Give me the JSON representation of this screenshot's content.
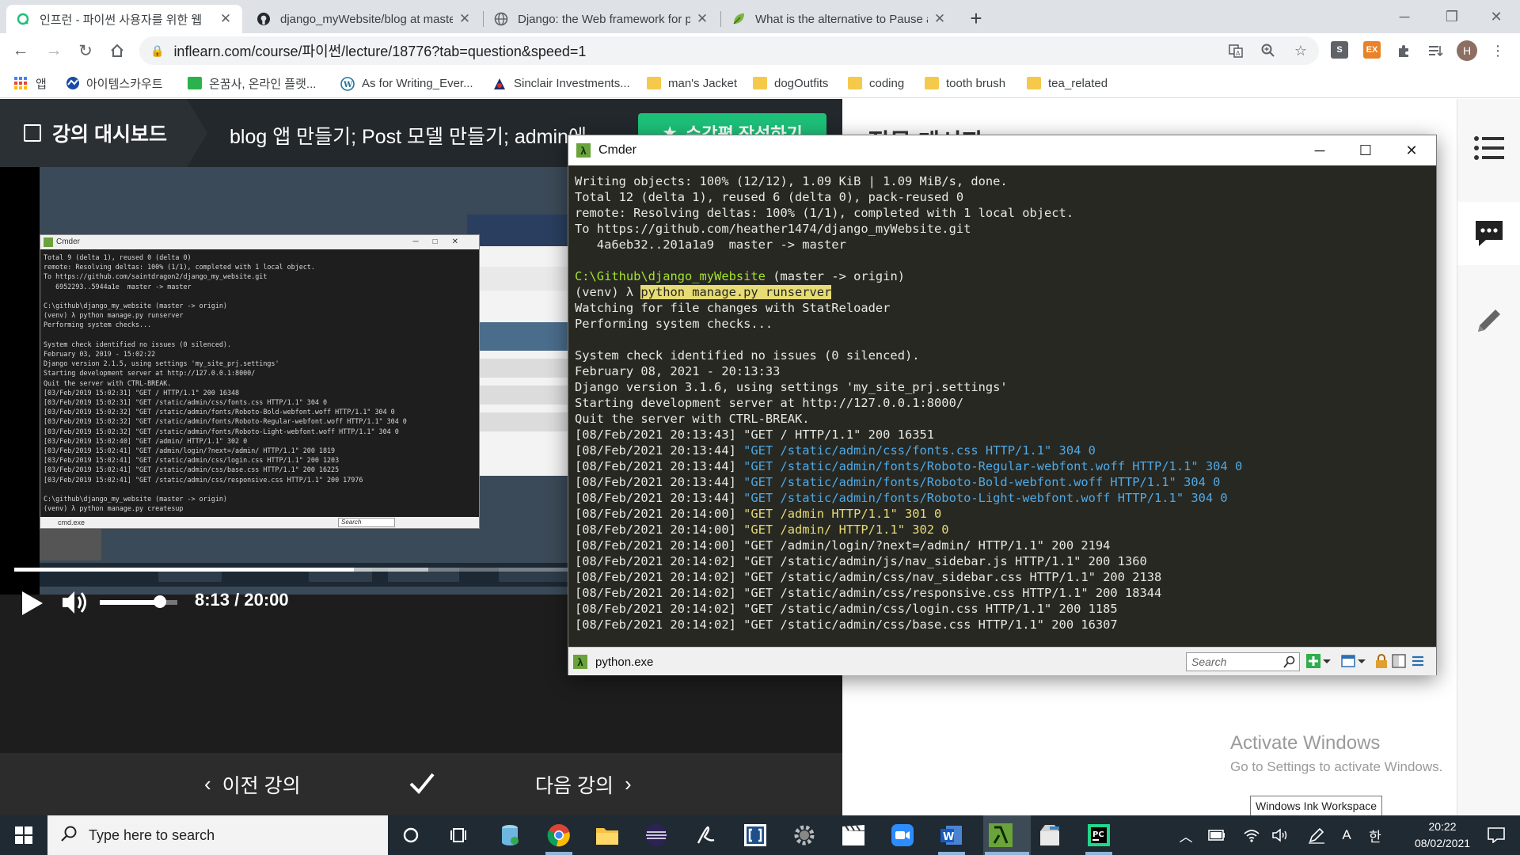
{
  "browser": {
    "tabs": [
      {
        "title": "인프런 - 파이썬 사용자를 위한 웹",
        "active": true
      },
      {
        "title": "django_myWebsite/blog at maste",
        "active": false
      },
      {
        "title": "Django: the Web framework for p",
        "active": false
      },
      {
        "title": "What is the alternative to Pause a",
        "active": false
      }
    ],
    "new_tab_label": "+",
    "url": "inflearn.com/course/파이썬/lecture/18776?tab=question&speed=1",
    "profile_initial": "H",
    "ext_s_label": "S",
    "ext_ex_label": "EX"
  },
  "bookmarks": [
    {
      "label": "앱"
    },
    {
      "label": "아이템스카우트"
    },
    {
      "label": "온꿈사, 온라인 플랫..."
    },
    {
      "label": "As for Writing_Ever..."
    },
    {
      "label": "Sinclair Investments..."
    },
    {
      "label": "man's Jacket"
    },
    {
      "label": "dogOutfits"
    },
    {
      "label": "coding"
    },
    {
      "label": "tooth brush"
    },
    {
      "label": "tea_related"
    }
  ],
  "lecture": {
    "dashboard_label": "강의 대시보드",
    "title": "blog 앱 만들기; Post 모델 만들기; admin에 ...",
    "review_button": "수강평 작성하기",
    "time_display": "8:13 / 20:00",
    "progress": 0.41,
    "buffered": 0.5,
    "volume": 0.78,
    "prev_label": "이전 강의",
    "next_label": "다음 강의"
  },
  "video_inner_cmder": {
    "title": "Cmder",
    "status_tab": "cmd.exe",
    "search_placeholder": "Search",
    "text": "Total 9 (delta 1), reused 0 (delta 0)\nremote: Resolving deltas: 100% (1/1), completed with 1 local object.\nTo https://github.com/saintdragon2/django_my_website.git\n   6952293..5944a1e  master -> master\n\nC:\\github\\django_my_website (master -> origin)\n(venv) λ python manage.py runserver\nPerforming system checks...\n\nSystem check identified no issues (0 silenced).\nFebruary 03, 2019 - 15:02:22\nDjango version 2.1.5, using settings 'my_site_prj.settings'\nStarting development server at http://127.0.0.1:8000/\nQuit the server with CTRL-BREAK.\n[03/Feb/2019 15:02:31] \"GET / HTTP/1.1\" 200 16348\n[03/Feb/2019 15:02:31] \"GET /static/admin/css/fonts.css HTTP/1.1\" 304 0\n[03/Feb/2019 15:02:32] \"GET /static/admin/fonts/Roboto-Bold-webfont.woff HTTP/1.1\" 304 0\n[03/Feb/2019 15:02:32] \"GET /static/admin/fonts/Roboto-Regular-webfont.woff HTTP/1.1\" 304 0\n[03/Feb/2019 15:02:32] \"GET /static/admin/fonts/Roboto-Light-webfont.woff HTTP/1.1\" 304 0\n[03/Feb/2019 15:02:40] \"GET /admin/ HTTP/1.1\" 302 0\n[03/Feb/2019 15:02:41] \"GET /admin/login/?next=/admin/ HTTP/1.1\" 200 1819\n[03/Feb/2019 15:02:41] \"GET /static/admin/css/login.css HTTP/1.1\" 200 1203\n[03/Feb/2019 15:02:41] \"GET /static/admin/css/base.css HTTP/1.1\" 200 16225\n[03/Feb/2019 15:02:41] \"GET /static/admin/css/responsive.css HTTP/1.1\" 200 17976\n\nC:\\github\\django_my_website (master -> origin)\n(venv) λ python manage.py createsup"
  },
  "qa": {
    "header": "질문 게시판"
  },
  "cmder": {
    "title": "Cmder",
    "status_tab": "python.exe",
    "search_placeholder": "Search",
    "lines": [
      [
        {
          "t": "Writing objects: 100% (12/12), 1.09 KiB | 1.09 MiB/s, done.",
          "c": ""
        }
      ],
      [
        {
          "t": "Total 12 (delta 1), reused 6 (delta 0), pack-reused 0",
          "c": ""
        }
      ],
      [
        {
          "t": "remote: Resolving deltas: 100% (1/1), completed with 1 local object.",
          "c": ""
        }
      ],
      [
        {
          "t": "To https://github.com/heather1474/django_myWebsite.git",
          "c": ""
        }
      ],
      [
        {
          "t": "   4a6eb32..201a1a9  master -> master",
          "c": ""
        }
      ],
      [
        {
          "t": "",
          "c": ""
        }
      ],
      [
        {
          "t": "C:\\Github\\django_myWebsite",
          "c": "c-green"
        },
        {
          "t": " (master -> origin)",
          "c": ""
        }
      ],
      [
        {
          "t": "(venv) λ ",
          "c": ""
        },
        {
          "t": "python manage.py runserver",
          "c": "c-hl"
        }
      ],
      [
        {
          "t": "Watching for file changes with StatReloader",
          "c": ""
        }
      ],
      [
        {
          "t": "Performing system checks...",
          "c": ""
        }
      ],
      [
        {
          "t": "",
          "c": ""
        }
      ],
      [
        {
          "t": "System check identified no issues (0 silenced).",
          "c": ""
        }
      ],
      [
        {
          "t": "February 08, 2021 - 20:13:33",
          "c": ""
        }
      ],
      [
        {
          "t": "Django version 3.1.6, using settings 'my_site_prj.settings'",
          "c": ""
        }
      ],
      [
        {
          "t": "Starting development server at http://127.0.0.1:8000/",
          "c": ""
        }
      ],
      [
        {
          "t": "Quit the server with CTRL-BREAK.",
          "c": ""
        }
      ],
      [
        {
          "t": "[08/Feb/2021 20:13:43] \"GET / HTTP/1.1\" 200 16351",
          "c": ""
        }
      ],
      [
        {
          "t": "[08/Feb/2021 20:13:44] ",
          "c": ""
        },
        {
          "t": "\"GET /static/admin/css/fonts.css HTTP/1.1\" 304 0",
          "c": "c-blue"
        }
      ],
      [
        {
          "t": "[08/Feb/2021 20:13:44] ",
          "c": ""
        },
        {
          "t": "\"GET /static/admin/fonts/Roboto-Regular-webfont.woff HTTP/1.1\" 304 0",
          "c": "c-blue"
        }
      ],
      [
        {
          "t": "[08/Feb/2021 20:13:44] ",
          "c": ""
        },
        {
          "t": "\"GET /static/admin/fonts/Roboto-Bold-webfont.woff HTTP/1.1\" 304 0",
          "c": "c-blue"
        }
      ],
      [
        {
          "t": "[08/Feb/2021 20:13:44] ",
          "c": ""
        },
        {
          "t": "\"GET /static/admin/fonts/Roboto-Light-webfont.woff HTTP/1.1\" 304 0",
          "c": "c-blue"
        }
      ],
      [
        {
          "t": "[08/Feb/2021 20:14:00] ",
          "c": ""
        },
        {
          "t": "\"GET /admin HTTP/1.1\" 301 0",
          "c": "c-yellow"
        }
      ],
      [
        {
          "t": "[08/Feb/2021 20:14:00] ",
          "c": ""
        },
        {
          "t": "\"GET /admin/ HTTP/1.1\" 302 0",
          "c": "c-yellow"
        }
      ],
      [
        {
          "t": "[08/Feb/2021 20:14:00] \"GET /admin/login/?next=/admin/ HTTP/1.1\" 200 2194",
          "c": ""
        }
      ],
      [
        {
          "t": "[08/Feb/2021 20:14:02] \"GET /static/admin/js/nav_sidebar.js HTTP/1.1\" 200 1360",
          "c": ""
        }
      ],
      [
        {
          "t": "[08/Feb/2021 20:14:02] \"GET /static/admin/css/nav_sidebar.css HTTP/1.1\" 200 2138",
          "c": ""
        }
      ],
      [
        {
          "t": "[08/Feb/2021 20:14:02] \"GET /static/admin/css/responsive.css HTTP/1.1\" 200 18344",
          "c": ""
        }
      ],
      [
        {
          "t": "[08/Feb/2021 20:14:02] \"GET /static/admin/css/login.css HTTP/1.1\" 200 1185",
          "c": ""
        }
      ],
      [
        {
          "t": "[08/Feb/2021 20:14:02] \"GET /static/admin/css/base.css HTTP/1.1\" 200 16307",
          "c": ""
        }
      ]
    ]
  },
  "watermark": {
    "line1": "Activate Windows",
    "line2": "Go to Settings to activate Windows."
  },
  "tooltip": "Windows Ink Workspace",
  "taskbar": {
    "search_placeholder": "Type here to search",
    "time": "20:22",
    "date": "08/02/2021",
    "ime_a": "A",
    "ime_han": "한"
  },
  "colors": {
    "inflearn_green": "#1dc078",
    "cmder_bg": "#272822",
    "taskbar": "#1f2a33"
  }
}
